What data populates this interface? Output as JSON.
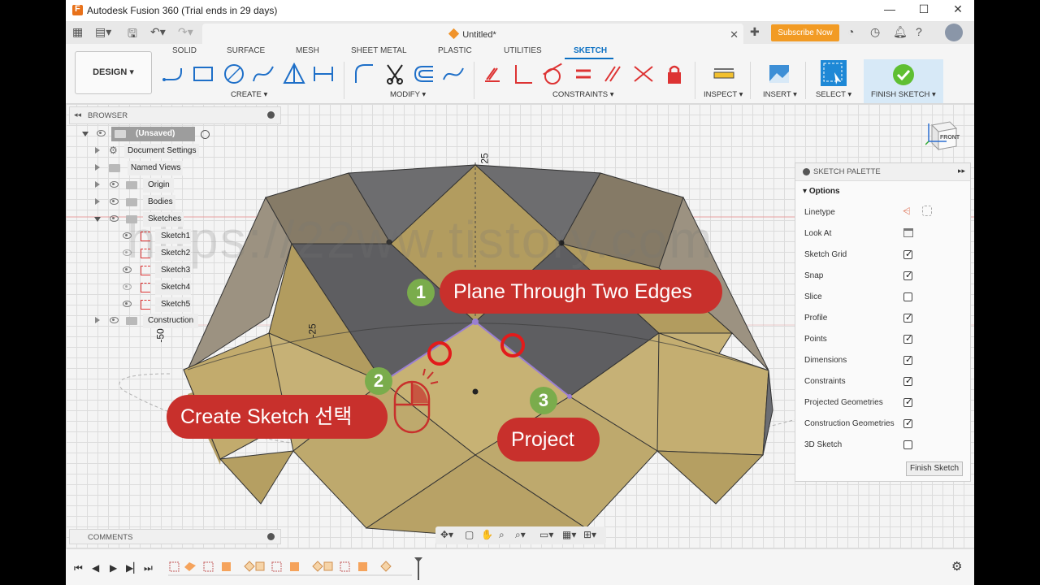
{
  "window": {
    "title": "Autodesk Fusion 360 (Trial ends in 29 days)",
    "controls": [
      "—",
      "☐",
      "✕"
    ]
  },
  "document_tab": {
    "name": "Untitled*",
    "close": "✕"
  },
  "subscribe_label": "Subscribe Now",
  "design_label": "DESIGN ▾",
  "ribbon_tabs": [
    "SOLID",
    "SURFACE",
    "MESH",
    "SHEET METAL",
    "PLASTIC",
    "UTILITIES",
    "SKETCH"
  ],
  "active_tab": "SKETCH",
  "ribbon_groups": [
    "CREATE ▾",
    "MODIFY ▾",
    "CONSTRAINTS ▾",
    "INSPECT ▾",
    "INSERT ▾",
    "SELECT ▾",
    "FINISH SKETCH ▾"
  ],
  "browser": {
    "header": "BROWSER",
    "root": "(Unsaved)",
    "items": [
      "Document Settings",
      "Named Views",
      "Origin",
      "Bodies",
      "Sketches",
      "Sketch1",
      "Sketch2",
      "Sketch3",
      "Sketch4",
      "Sketch5",
      "Construction"
    ]
  },
  "palette": {
    "header": "SKETCH PALETTE",
    "section": "Options",
    "rows": [
      {
        "label": "Linetype",
        "kind": "icons"
      },
      {
        "label": "Look At",
        "kind": "icon"
      },
      {
        "label": "Sketch Grid",
        "kind": "check",
        "checked": true
      },
      {
        "label": "Snap",
        "kind": "check",
        "checked": true
      },
      {
        "label": "Slice",
        "kind": "check",
        "checked": false
      },
      {
        "label": "Profile",
        "kind": "check",
        "checked": true
      },
      {
        "label": "Points",
        "kind": "check",
        "checked": true
      },
      {
        "label": "Dimensions",
        "kind": "check",
        "checked": true
      },
      {
        "label": "Constraints",
        "kind": "check",
        "checked": true
      },
      {
        "label": "Projected Geometries",
        "kind": "check",
        "checked": true
      },
      {
        "label": "Construction Geometries",
        "kind": "check",
        "checked": true
      },
      {
        "label": "3D Sketch",
        "kind": "check",
        "checked": false
      }
    ],
    "finish_button": "Finish Sketch"
  },
  "comments": "COMMENTS",
  "dimensions": {
    "top": "25",
    "left": "-25",
    "far_left": "-50"
  },
  "viewcube": "FRONT",
  "annotations": [
    {
      "num": "1",
      "text": "Plane Through Two Edges"
    },
    {
      "num": "2",
      "text": "Create Sketch 선택"
    },
    {
      "num": "3",
      "text": "Project"
    }
  ],
  "watermark": "https://22ww.tistory.com",
  "colors": {
    "accent": "#0a6fc2",
    "badge": "#c8302c",
    "step": "#7aac4c",
    "subscribe": "#f29b24"
  }
}
